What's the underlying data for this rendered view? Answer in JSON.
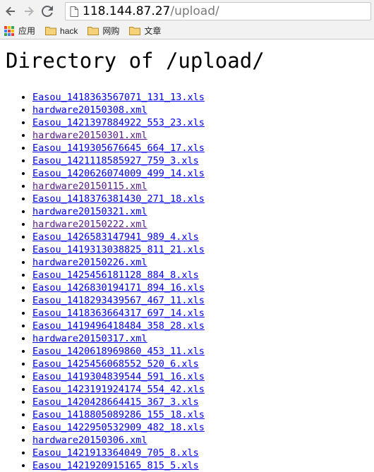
{
  "browser": {
    "url_host": "118.144.87.27",
    "url_path": "/upload/",
    "bookmarks": [
      {
        "label": "应用",
        "icon": "apps-icon"
      },
      {
        "label": "hack",
        "icon": "folder-icon"
      },
      {
        "label": "网购",
        "icon": "folder-icon"
      },
      {
        "label": "文章",
        "icon": "folder-icon"
      }
    ]
  },
  "page": {
    "title": "Directory of /upload/",
    "files": [
      {
        "name": "Easou_1418363567071_131_13.xls",
        "visited": false
      },
      {
        "name": "hardware20150308.xml",
        "visited": false
      },
      {
        "name": "Easou_1421397884922_553_23.xls",
        "visited": false
      },
      {
        "name": "hardware20150301.xml",
        "visited": true
      },
      {
        "name": "Easou_1419305676645_664_17.xls",
        "visited": false
      },
      {
        "name": "Easou_1421118585927_759_3.xls",
        "visited": false
      },
      {
        "name": "Easou_1420626074009_499_14.xls",
        "visited": false
      },
      {
        "name": "hardware20150115.xml",
        "visited": true
      },
      {
        "name": "Easou_1418376381430_271_18.xls",
        "visited": false
      },
      {
        "name": "hardware20150321.xml",
        "visited": false
      },
      {
        "name": "hardware20150222.xml",
        "visited": true
      },
      {
        "name": "Easou_1426583147941_989_4.xls",
        "visited": false
      },
      {
        "name": "Easou_1419313038825_811_21.xls",
        "visited": false
      },
      {
        "name": "hardware20150226.xml",
        "visited": false
      },
      {
        "name": "Easou_1425456181128_884_8.xls",
        "visited": false
      },
      {
        "name": "Easou_1426830194171_894_16.xls",
        "visited": false
      },
      {
        "name": "Easou_1418293439567_467_11.xls",
        "visited": false
      },
      {
        "name": "Easou_1418363664317_697_14.xls",
        "visited": false
      },
      {
        "name": "Easou_1419496418484_358_28.xls",
        "visited": false
      },
      {
        "name": "hardware20150317.xml",
        "visited": false
      },
      {
        "name": "Easou_1420618969860_453_11.xls",
        "visited": false
      },
      {
        "name": "Easou_1425456068552_520_6.xls",
        "visited": false
      },
      {
        "name": "Easou_1419304839544_591_16.xls",
        "visited": false
      },
      {
        "name": "Easou_1423191924174_554_42.xls",
        "visited": false
      },
      {
        "name": "Easou_1420428664415_367_3.xls",
        "visited": false
      },
      {
        "name": "Easou_1418805089286_155_18.xls",
        "visited": false
      },
      {
        "name": "Easou_1422950532909_482_18.xls",
        "visited": false
      },
      {
        "name": "hardware20150306.xml",
        "visited": false
      },
      {
        "name": "Easou_1421913364049_705_8.xls",
        "visited": false
      },
      {
        "name": "Easou_1421920915165_815_5.xls",
        "visited": false
      }
    ]
  },
  "colors": {
    "link": "#0000ee",
    "visited_link": "#551a8b",
    "chrome_bg": "#f2f2f2"
  }
}
